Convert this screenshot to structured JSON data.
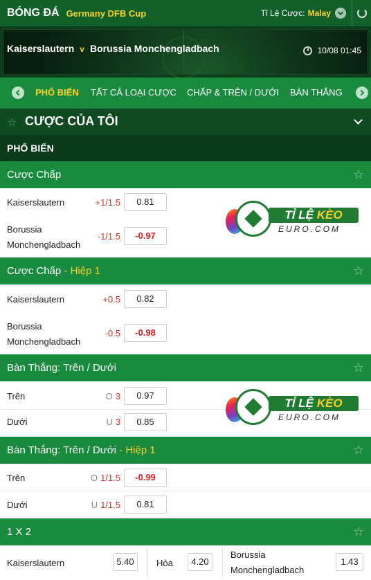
{
  "header": {
    "sport": "BÓNG ĐÁ",
    "league": "Germany DFB Cup",
    "odds_format_label": "Tỉ Lệ Cược:",
    "odds_format_value": "Malay"
  },
  "match": {
    "home": "Kaiserslautern",
    "vs": "v",
    "away": "Borussia Monchengladbach",
    "kickoff": "10/08  01:45"
  },
  "tabs": [
    {
      "label": "PHỔ BIẾN",
      "active": true
    },
    {
      "label": "TẤT CẢ LOẠI CƯỢC",
      "active": false
    },
    {
      "label": "CHẤP & TRÊN / DƯỚI",
      "active": false
    },
    {
      "label": "BÀN THẮNG",
      "active": false
    }
  ],
  "my_bets": {
    "title": "CƯỢC CỦA TÔI"
  },
  "section": {
    "title": "PHỔ BIẾN"
  },
  "markets": {
    "handicap": {
      "title": "Cược Chấp",
      "rows": [
        {
          "name": "Kaiserslautern",
          "line": "+1/1.5",
          "odds": "0.81"
        },
        {
          "name1": "Borussia",
          "name2": "Monchengladbach",
          "line": "-1/1.5",
          "odds": "-0.97"
        }
      ]
    },
    "handicap_h1": {
      "title": "Cược Chấp",
      "suffix": " - Hiệp 1",
      "rows": [
        {
          "name": "Kaiserslautern",
          "line": "+0.5",
          "odds": "0.82"
        },
        {
          "name1": "Borussia",
          "name2": "Monchengladbach",
          "line": "-0.5",
          "odds": "-0.98"
        }
      ]
    },
    "ou": {
      "title": "Bàn Thắng: Trên / Dưới",
      "rows": [
        {
          "name": "Trên",
          "lab": "O",
          "line": "3",
          "odds": "0.97"
        },
        {
          "name": "Dưới",
          "lab": "U",
          "line": "3",
          "odds": "0.85"
        }
      ]
    },
    "ou_h1": {
      "title": "Bàn Thắng: Trên / Dưới",
      "suffix": " - Hiệp 1",
      "rows": [
        {
          "name": "Trên",
          "lab": "O",
          "line": "1/1.5",
          "odds": "-0.99"
        },
        {
          "name": "Dưới",
          "lab": "U",
          "line": "1/1.5",
          "odds": "0.81"
        }
      ]
    },
    "x12": {
      "title": "1 X 2",
      "home_name": "Kaiserslautern",
      "home_odds": "5.40",
      "draw_name": "Hòa",
      "draw_odds": "4.20",
      "away_name1": "Borussia",
      "away_name2": "Monchengladbach",
      "away_odds": "1.43"
    }
  },
  "watermark": {
    "brand_a": "TỈ LỆ",
    "brand_b": "KÈO",
    "sub": "EURO.COM"
  }
}
